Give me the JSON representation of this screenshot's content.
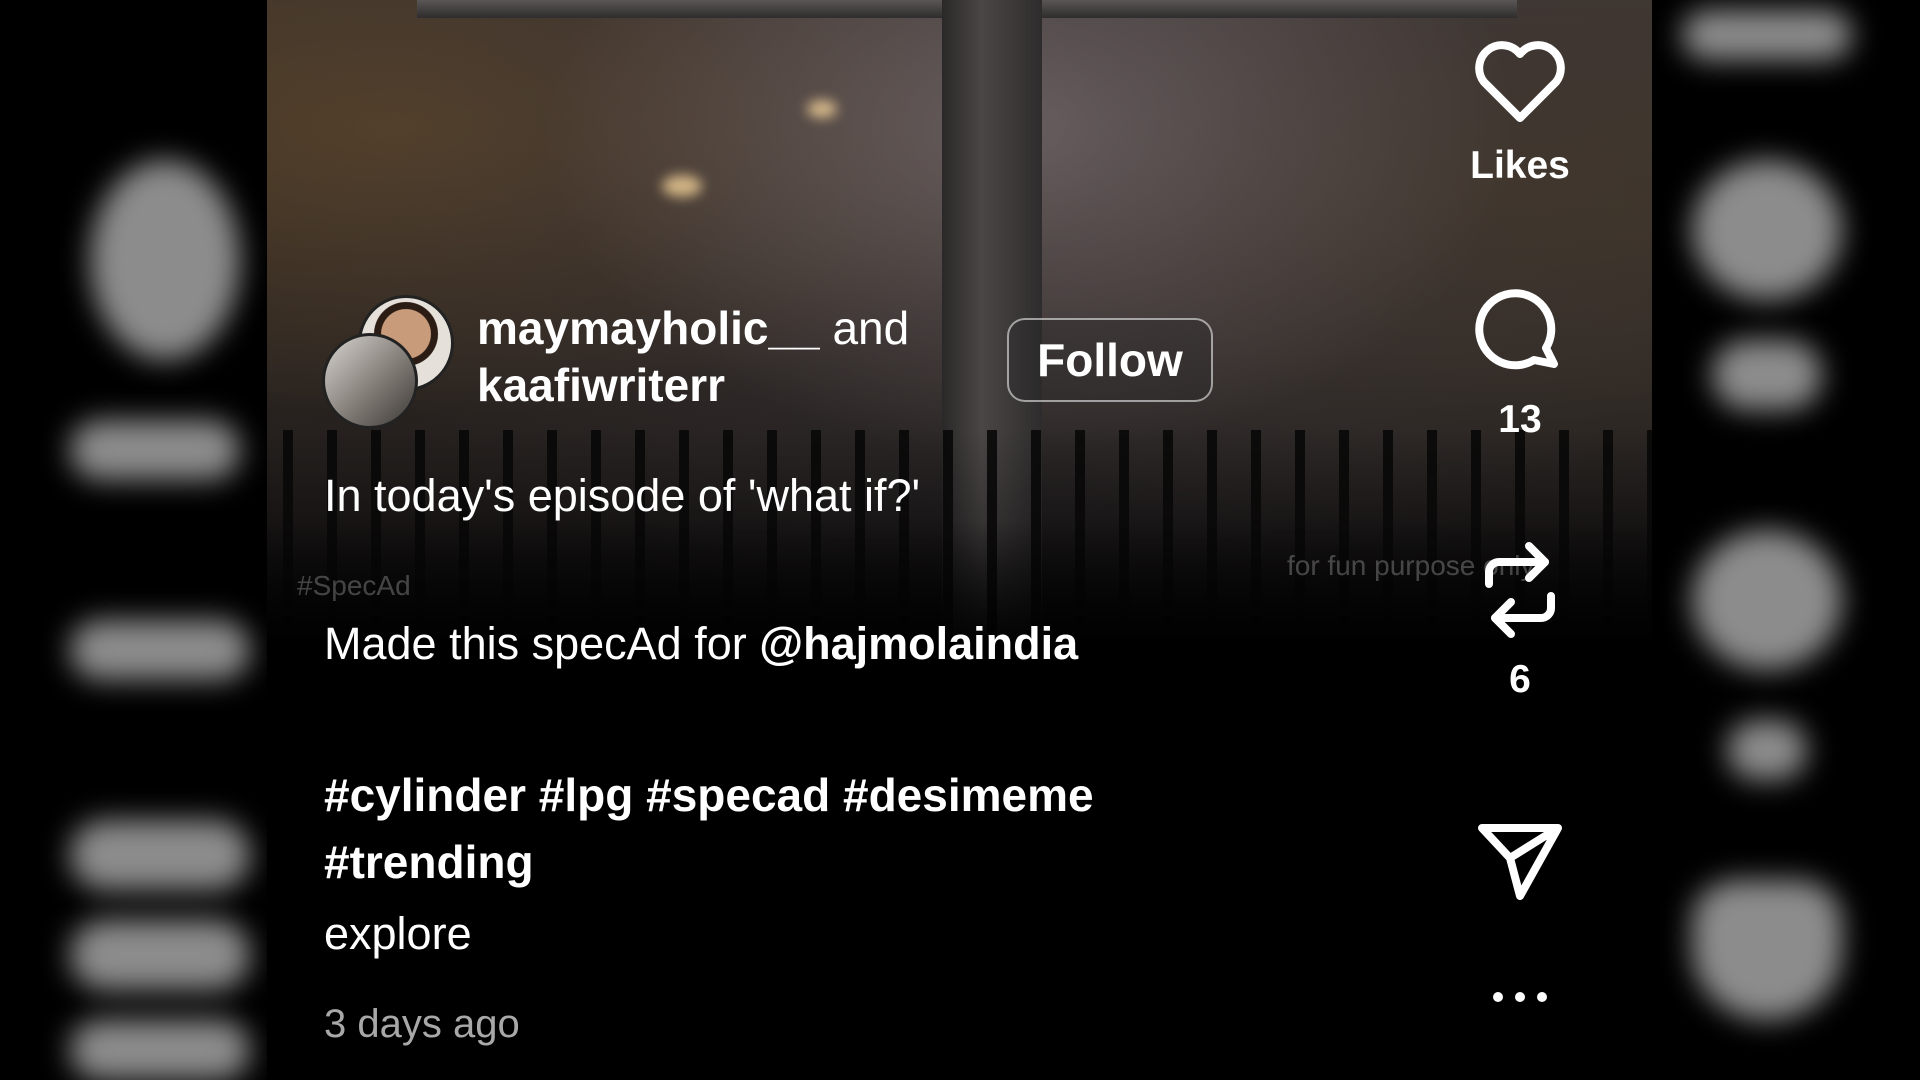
{
  "post": {
    "author_primary": "maymayholic__",
    "author_joiner": "and",
    "author_secondary": "kaafiwriterr",
    "follow_label": "Follow",
    "caption_line1": "In today's episode of 'what if?'",
    "caption_line2_prefix": "Made this specAd for",
    "caption_mention": "@hajmolaindia",
    "hashtags_line1": "#cylinder #lpg #specad #desimeme",
    "hashtags_line2": "#trending",
    "explore_label": "explore",
    "timestamp": "3 days ago"
  },
  "video_overlay": {
    "tag_left": "#SpecAd",
    "tag_right": "for fun purpose only"
  },
  "actions": {
    "likes_label": "Likes",
    "comments_count": "13",
    "reposts_count": "6"
  },
  "icons": {
    "like": "heart-icon",
    "comment": "comment-bubble-icon",
    "repost": "repost-arrows-icon",
    "share": "paper-plane-icon",
    "more": "more-dots-icon"
  },
  "colors": {
    "text": "#ffffff",
    "muted": "#a8a8a8",
    "background": "#000000"
  }
}
